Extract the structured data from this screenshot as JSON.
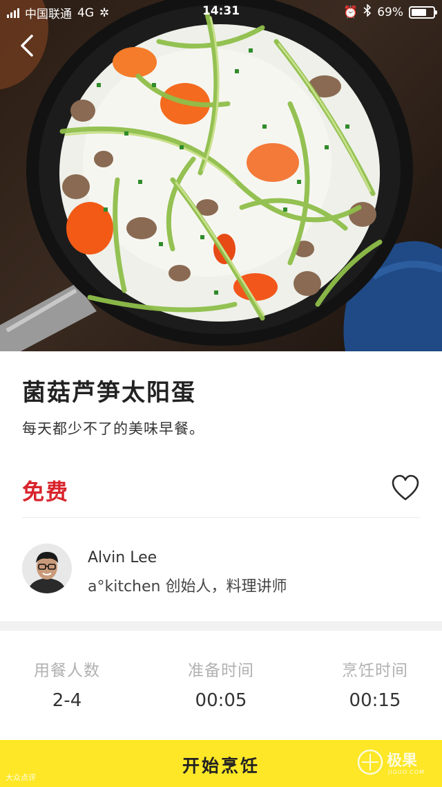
{
  "status_bar": {
    "carrier": "中国联通",
    "network": "4G",
    "time": "14:31",
    "battery": "69%",
    "battery_level": 0.69
  },
  "recipe": {
    "title": "菌菇芦笋太阳蛋",
    "subtitle": "每天都少不了的美味早餐。",
    "price": "免费"
  },
  "author": {
    "name": "Alvin Lee",
    "description": "a°kitchen 创始人，料理讲师"
  },
  "stats": [
    {
      "label": "用餐人数",
      "value": "2-4"
    },
    {
      "label": "准备时间",
      "value": "00:05"
    },
    {
      "label": "烹饪时间",
      "value": "00:15"
    }
  ],
  "cta": {
    "label": "开始烹饪"
  },
  "watermarks": {
    "left": "大众点评",
    "right": "极果",
    "right_sub": "JIGUO.COM"
  },
  "colors": {
    "accent_yellow": "#fde726",
    "price_red": "#d8242c",
    "label_gray": "#b1b1b1"
  },
  "icons": [
    "back-chevron-icon",
    "heart-outline-icon",
    "signal-icon",
    "loading-icon",
    "alarm-icon",
    "bluetooth-icon",
    "battery-icon"
  ]
}
